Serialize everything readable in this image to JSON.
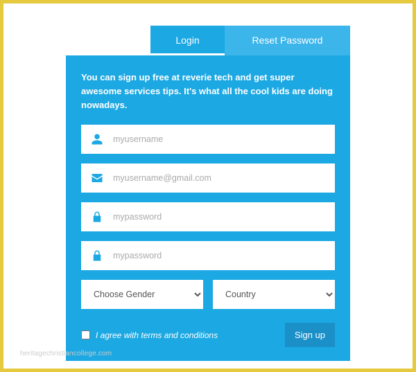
{
  "tabs": {
    "login": "Login",
    "reset": "Reset Password"
  },
  "intro": "You can sign up free at reverie tech and get super awesome services tips. It's what all the cool kids are doing nowadays.",
  "fields": {
    "username": {
      "placeholder": "myusername"
    },
    "email": {
      "placeholder": "myusername@gmail.com"
    },
    "password": {
      "placeholder": "mypassword"
    },
    "confirm": {
      "placeholder": "mypassword"
    }
  },
  "selects": {
    "gender": {
      "label": "Choose Gender"
    },
    "country": {
      "label": "Country"
    }
  },
  "agree_label": "I agree with terms and conditions",
  "signup_label": "Sign up",
  "watermark": "heritagechristiancollege.com"
}
